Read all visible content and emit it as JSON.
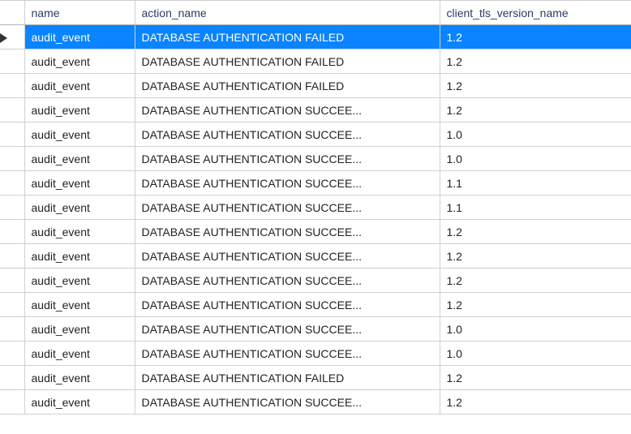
{
  "grid": {
    "columns": {
      "name": "name",
      "action_name": "action_name",
      "client_tls_version_name": "client_tls_version_name"
    },
    "selectedRow": 0,
    "rows": [
      {
        "name": "audit_event",
        "action_name": "DATABASE AUTHENTICATION FAILED",
        "tls": "1.2"
      },
      {
        "name": "audit_event",
        "action_name": "DATABASE AUTHENTICATION FAILED",
        "tls": "1.2"
      },
      {
        "name": "audit_event",
        "action_name": "DATABASE AUTHENTICATION FAILED",
        "tls": "1.2"
      },
      {
        "name": "audit_event",
        "action_name": "DATABASE AUTHENTICATION SUCCEE...",
        "tls": "1.2"
      },
      {
        "name": "audit_event",
        "action_name": "DATABASE AUTHENTICATION SUCCEE...",
        "tls": "1.0"
      },
      {
        "name": "audit_event",
        "action_name": "DATABASE AUTHENTICATION SUCCEE...",
        "tls": "1.0"
      },
      {
        "name": "audit_event",
        "action_name": "DATABASE AUTHENTICATION SUCCEE...",
        "tls": "1.1"
      },
      {
        "name": "audit_event",
        "action_name": "DATABASE AUTHENTICATION SUCCEE...",
        "tls": "1.1"
      },
      {
        "name": "audit_event",
        "action_name": "DATABASE AUTHENTICATION SUCCEE...",
        "tls": "1.2"
      },
      {
        "name": "audit_event",
        "action_name": "DATABASE AUTHENTICATION SUCCEE...",
        "tls": "1.2"
      },
      {
        "name": "audit_event",
        "action_name": "DATABASE AUTHENTICATION SUCCEE...",
        "tls": "1.2"
      },
      {
        "name": "audit_event",
        "action_name": "DATABASE AUTHENTICATION SUCCEE...",
        "tls": "1.2"
      },
      {
        "name": "audit_event",
        "action_name": "DATABASE AUTHENTICATION SUCCEE...",
        "tls": "1.0"
      },
      {
        "name": "audit_event",
        "action_name": "DATABASE AUTHENTICATION SUCCEE...",
        "tls": "1.0"
      },
      {
        "name": "audit_event",
        "action_name": "DATABASE AUTHENTICATION FAILED",
        "tls": "1.2"
      },
      {
        "name": "audit_event",
        "action_name": "DATABASE AUTHENTICATION SUCCEE...",
        "tls": "1.2"
      }
    ]
  }
}
